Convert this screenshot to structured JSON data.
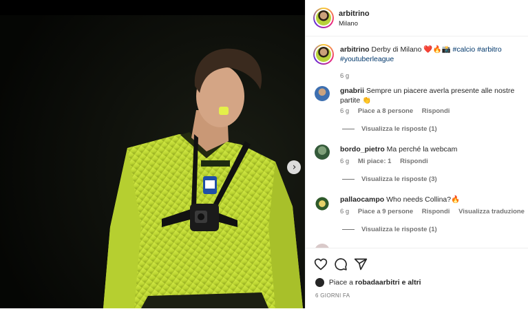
{
  "post": {
    "author": "arbitrino",
    "location": "Milano"
  },
  "caption": {
    "username": "arbitrino",
    "text": "Derby di Milano ❤️🔥📸",
    "hashtags": [
      "#calcio",
      "#arbitro",
      "#youtuberleague"
    ],
    "time": "6 g"
  },
  "comments": [
    {
      "username": "gnabrii",
      "text": "Sempre un piacere averla presente alle nostre partite 👏",
      "time": "6 g",
      "likes": "Piace a 8 persone",
      "reply": "Rispondi",
      "view_replies": "Visualizza le risposte (1)"
    },
    {
      "username": "bordo_pietro",
      "text": "Ma perché la webcam",
      "time": "6 g",
      "likes": "Mi piace: 1",
      "reply": "Rispondi",
      "view_replies": "Visualizza le risposte (3)"
    },
    {
      "username": "pallaocampo",
      "text": "Who needs Collina?🔥",
      "time": "6 g",
      "likes": "Piace a 9 persone",
      "reply": "Rispondi",
      "translate": "Visualizza traduzione",
      "view_replies": "Visualizza le risposte (1)"
    }
  ],
  "actions": {
    "icons": [
      "heart-icon",
      "comment-icon",
      "share-icon"
    ]
  },
  "likes_summary": {
    "prefix": "Piace a",
    "user": "robadaarbitri",
    "suffix": "e altri"
  },
  "date": "6 GIORNI FA",
  "colors": {
    "link": "#00376b",
    "muted": "#737373",
    "shirt": "#c6e03a"
  }
}
